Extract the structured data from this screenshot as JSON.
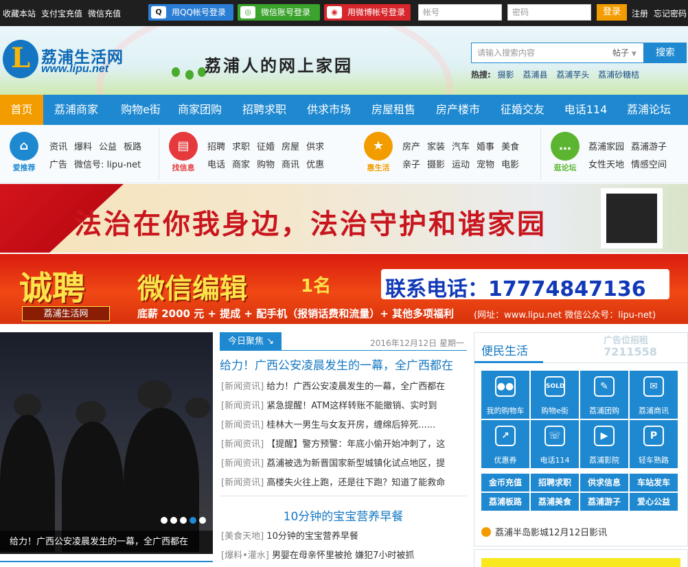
{
  "topbar": {
    "links": [
      "收藏本站",
      "支付宝充值",
      "微信充值"
    ],
    "qq_login": "用QQ帐号登录",
    "wechat_login": "微信账号登录",
    "weibo_login": "用微博帐号登录",
    "username_placeholder": "帐号",
    "password_placeholder": "密码",
    "login": "登录",
    "register": "注册",
    "forgot": "忘记密码"
  },
  "header": {
    "logo_cn": "荔浦生活网",
    "logo_en": "www.lipu.net",
    "logo_letter": "L",
    "slogan": "荔浦人的网上家园",
    "search_placeholder": "请输入搜索内容",
    "search_type": "帖子",
    "search_button": "搜索",
    "hot_label": "热搜:",
    "hot_items": [
      "摄影",
      "荔浦县",
      "荔浦芋头",
      "荔浦砂糖桔"
    ]
  },
  "nav": [
    "首页",
    "荔浦商家",
    "购物e街",
    "商家团购",
    "招聘求职",
    "供求市场",
    "房屋租售",
    "房产楼市",
    "征婚交友",
    "电话114",
    "荔浦论坛"
  ],
  "categories": [
    {
      "label": "爱推荐",
      "icon": "home-icon",
      "color": "#1e88d0",
      "row1": [
        "资讯",
        "爆料",
        "公益",
        "板路"
      ],
      "row2": [
        "广告",
        "微信号: lipu-net"
      ]
    },
    {
      "label": "找信息",
      "icon": "info-icon",
      "color": "#e5393c",
      "row1": [
        "招聘",
        "求职",
        "征婚",
        "房屋",
        "供求"
      ],
      "row2": [
        "电话",
        "商家",
        "购物",
        "商讯",
        "优惠"
      ]
    },
    {
      "label": "惠生活",
      "icon": "star-bag-icon",
      "color": "#f39c00",
      "row1": [
        "房产",
        "家装",
        "汽车",
        "婚事",
        "美食"
      ],
      "row2": [
        "亲子",
        "摄影",
        "运动",
        "宠物",
        "电影"
      ]
    },
    {
      "label": "逛论坛",
      "icon": "chat-icon",
      "color": "#5cb531",
      "row1": [
        "荔浦家园",
        "荔浦游子"
      ],
      "row2": [
        "女性天地",
        "情感空间"
      ]
    }
  ],
  "banner1": {
    "text": "法治在你我身边，法治守护和谐家园"
  },
  "banner2": {
    "big": "诚聘",
    "brand": "荔浦生活网",
    "position": "微信编辑",
    "count": "1名",
    "phone": "联系电话：17774847136",
    "benefits": "底薪 2000 元 + 提成 + 配手机（报销话费和流量）+ 其他多项福利",
    "site": "(网址：www.lipu.net   微信公众号：lipu-net)"
  },
  "photo": {
    "caption": "给力！广西公安凌晨发生的一幕，全广西都在",
    "dots": 5,
    "current": 4
  },
  "news": {
    "tab": "今日聚焦 ↘",
    "date": "2016年12月12日 星期一",
    "headline": "给力！广西公安凌晨发生的一幕，全广西都在",
    "items": [
      {
        "cat": "[新闻资讯]",
        "title": "给力！广西公安凌晨发生的一幕，全广西都在"
      },
      {
        "cat": "[新闻资讯]",
        "title": "紧急提醒！ATM这样转账不能撤销、实时到"
      },
      {
        "cat": "[新闻资讯]",
        "title": "桂林大一男生与女友开房，缠绵后猝死......"
      },
      {
        "cat": "[新闻资讯]",
        "title": "【提醒】警方预警：年底小偷开始冲刺了，这"
      },
      {
        "cat": "[新闻资讯]",
        "title": "荔浦被选为新晋国家新型城镇化试点地区，提"
      },
      {
        "cat": "[新闻资讯]",
        "title": "高楼失火往上跑，还是往下跑？知道了能救命"
      }
    ],
    "headline2": "10分钟的宝宝营养早餐",
    "items2": [
      {
        "cat": "[美食天地]",
        "title": "10分钟的宝宝营养早餐"
      },
      {
        "cat": "[爆料•灌水]",
        "title": "男婴在母亲怀里被抢 嫌犯7小时被抓"
      }
    ]
  },
  "side": {
    "title": "便民生活",
    "ad_line1": "广告位招租",
    "ad_line2": "7211558",
    "grid": [
      {
        "label": "我的购物车",
        "icon": "users-icon",
        "glyph": "●●"
      },
      {
        "label": "购物e街",
        "icon": "shopping-bag-icon",
        "glyph": "SOLD"
      },
      {
        "label": "荔浦团购",
        "icon": "tag-icon",
        "glyph": "✎"
      },
      {
        "label": "荔浦商讯",
        "icon": "mail-icon",
        "glyph": "✉"
      },
      {
        "label": "优惠券",
        "icon": "chart-icon",
        "glyph": "↗"
      },
      {
        "label": "电话114",
        "icon": "phone-icon",
        "glyph": "☏"
      },
      {
        "label": "荔浦影院",
        "icon": "film-icon",
        "glyph": "▶"
      },
      {
        "label": "轻车熟路",
        "icon": "parking-icon",
        "glyph": "P"
      }
    ],
    "buttons": [
      "金币充值",
      "招聘求职",
      "供求信息",
      "车站发车",
      "荔浦板路",
      "荔浦美食",
      "荔浦游子",
      "爱心公益"
    ],
    "notice": "荔浦半岛影城12月12日影讯"
  }
}
